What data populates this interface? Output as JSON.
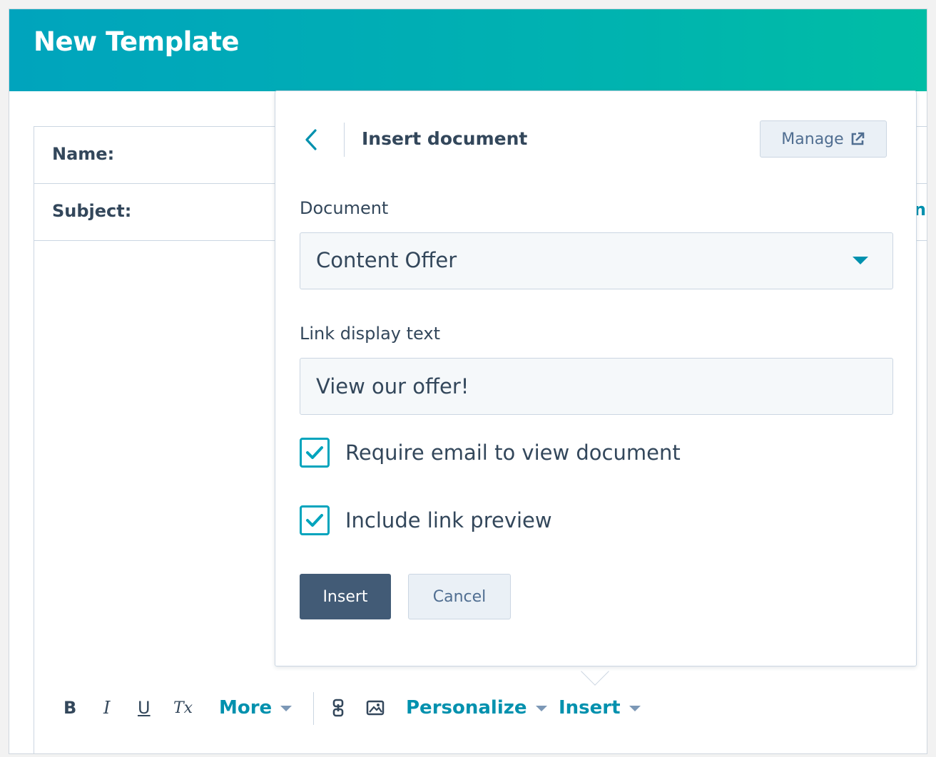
{
  "header": {
    "title": "New Template"
  },
  "form": {
    "name_label": "Name:",
    "subject_label": "Subject:",
    "peek_text": "n"
  },
  "popover": {
    "title": "Insert document",
    "manage_label": "Manage",
    "document_label": "Document",
    "document_value": "Content Offer",
    "link_label": "Link display text",
    "link_value": "View our offer!",
    "require_email_label": "Require email to view document",
    "require_email_checked": true,
    "include_preview_label": "Include link preview",
    "include_preview_checked": true,
    "insert_label": "Insert",
    "cancel_label": "Cancel"
  },
  "toolbar": {
    "bold_icon": "B",
    "italic_icon": "I",
    "underline_icon": "U",
    "clear_format_icon": "Tx",
    "more_label": "More",
    "personalize_label": "Personalize",
    "insert_label": "Insert"
  },
  "colors": {
    "header_start": "#00a4bd",
    "header_end": "#00bda5",
    "accent": "#00a4bd",
    "link": "#0091ae",
    "primary_button": "#425b76",
    "text": "#33475b"
  },
  "icons": {
    "back": "chevron-left-icon",
    "manage": "external-link-icon",
    "dropdown": "caret-down-icon",
    "checkbox": "checkmark-icon",
    "link": "link-icon",
    "image": "image-icon"
  }
}
